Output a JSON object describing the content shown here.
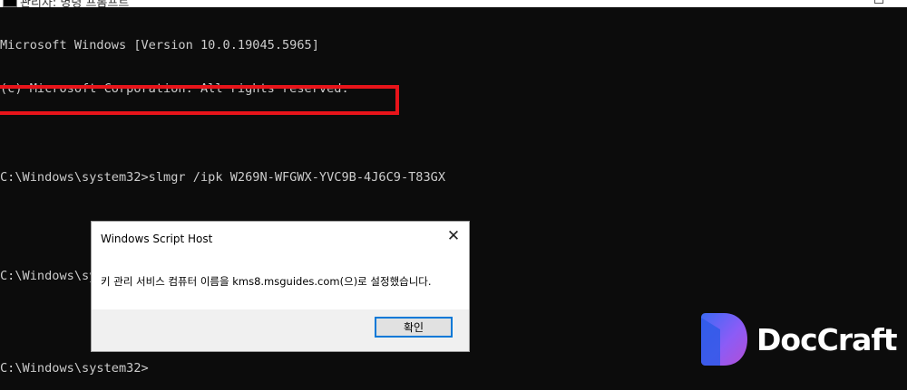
{
  "window": {
    "title": "관리자: 명령 프롬프트",
    "icon": "cmd-icon",
    "maximize_icon": "maximize-icon"
  },
  "console": {
    "lines": [
      "Microsoft Windows [Version 10.0.19045.5965]",
      "(c) Microsoft Corporation. All rights reserved.",
      "",
      "C:\\Windows\\system32>slmgr /ipk W269N-WFGWX-YVC9B-4J6C9-T83GX",
      "",
      "C:\\Windows\\system32>slmgr /skms kms8.msguides.com",
      "",
      "C:\\Windows\\system32>"
    ],
    "text_color": "#cccccc",
    "background": "#0c0c0c"
  },
  "highlight": {
    "color": "#e8141a"
  },
  "dialog": {
    "title": "Windows Script Host",
    "close_label": "✕",
    "message": "키 관리 서비스 컴퓨터 이름을 kms8.msguides.com(으)로 설정했습니다.",
    "ok_label": "확인"
  },
  "brand": {
    "name": "DocCraft",
    "logo_colors": [
      "#3b6bf5",
      "#8b5cf6",
      "#b24fd6"
    ]
  }
}
